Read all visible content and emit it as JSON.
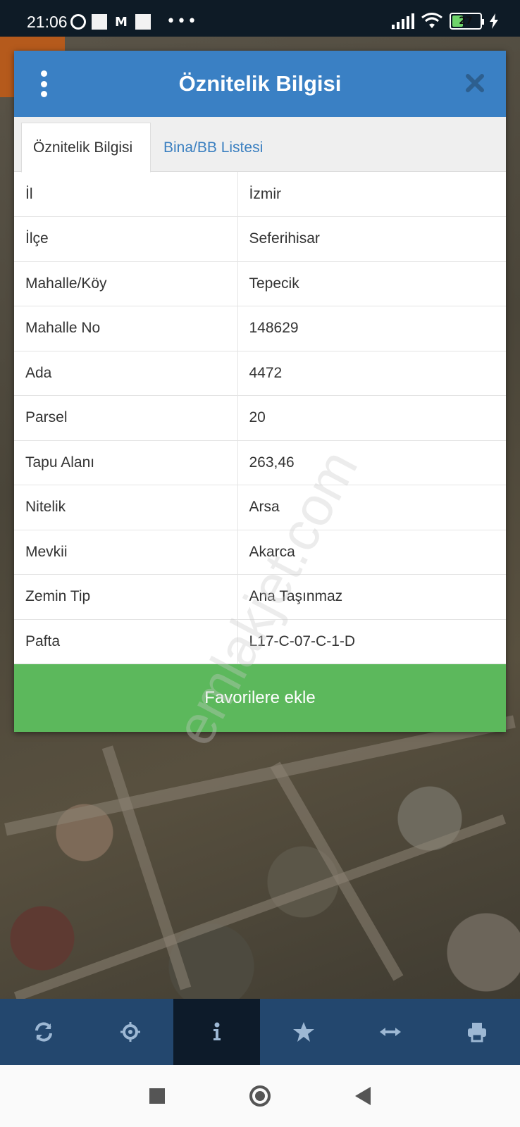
{
  "status_bar": {
    "time": "21:06",
    "battery": "27"
  },
  "modal": {
    "title": "Öznitelik Bilgisi",
    "tabs": [
      {
        "label": "Öznitelik Bilgisi",
        "active": true
      },
      {
        "label": "Bina/BB Listesi",
        "active": false
      }
    ],
    "rows": [
      {
        "key": "İl",
        "value": "İzmir"
      },
      {
        "key": "İlçe",
        "value": "Seferihisar"
      },
      {
        "key": "Mahalle/Köy",
        "value": "Tepecik"
      },
      {
        "key": "Mahalle No",
        "value": "148629"
      },
      {
        "key": "Ada",
        "value": "4472"
      },
      {
        "key": "Parsel",
        "value": "20"
      },
      {
        "key": "Tapu Alanı",
        "value": "263,46"
      },
      {
        "key": "Nitelik",
        "value": "Arsa"
      },
      {
        "key": "Mevkii",
        "value": "Akarca"
      },
      {
        "key": "Zemin Tip",
        "value": "Ana Taşınmaz"
      },
      {
        "key": "Pafta",
        "value": "L17-C-07-C-1-D"
      }
    ],
    "favorite_button": "Favorilere ekle"
  },
  "watermark": "emlakjet.com",
  "toolbar": {
    "icons": [
      "refresh-icon",
      "locate-icon",
      "info-icon",
      "star-icon",
      "measure-icon",
      "print-icon"
    ],
    "active": "info-icon"
  },
  "colors": {
    "header": "#3a80c4",
    "button": "#5cb85c",
    "toolbar": "#23476e",
    "tab_link": "#3a7fc0"
  }
}
